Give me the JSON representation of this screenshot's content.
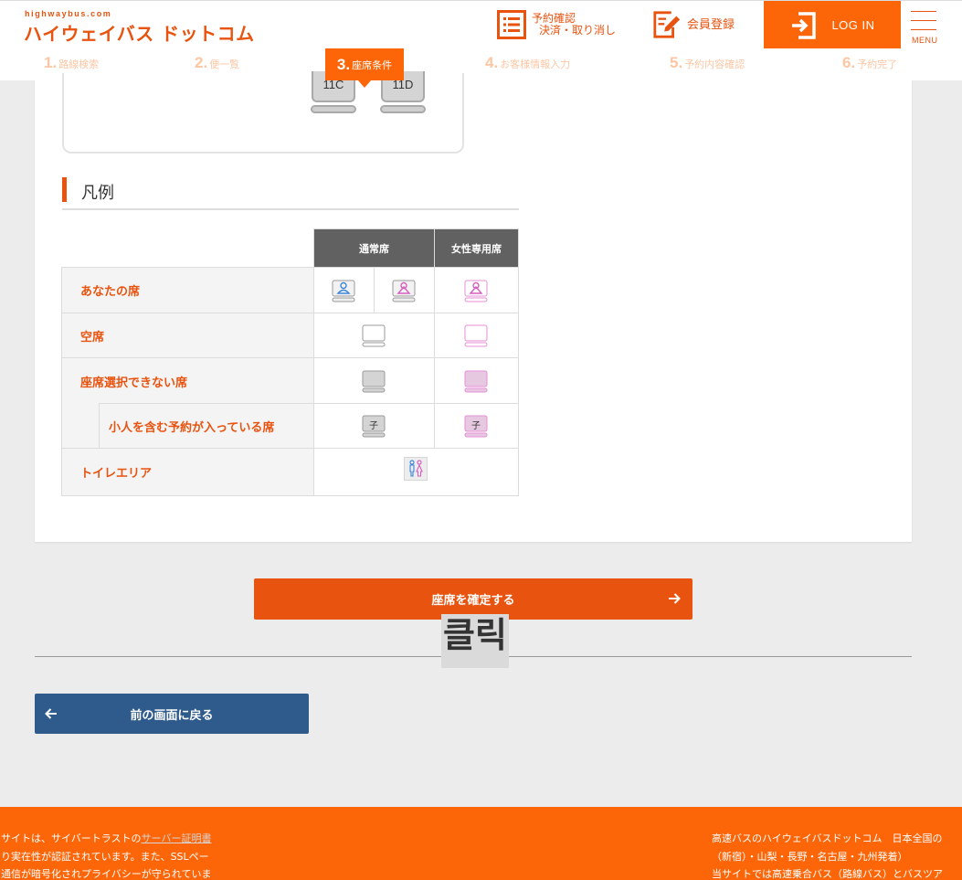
{
  "header": {
    "logo_small": "highwaybus.com",
    "logo_main": "ハイウェイバス ドットコム",
    "reservation_line1": "予約確認",
    "reservation_line2": "決済・取り消し",
    "register": "会員登録",
    "login": "LOG IN",
    "menu": "MENU"
  },
  "steps": [
    {
      "num": "1.",
      "label": "路線検索"
    },
    {
      "num": "2.",
      "label": "便一覧"
    },
    {
      "num": "3.",
      "label": "座席条件"
    },
    {
      "num": "4.",
      "label": "お客様情報入力"
    },
    {
      "num": "5.",
      "label": "予約内容確認"
    },
    {
      "num": "6.",
      "label": "予約完了"
    }
  ],
  "active_step": 3,
  "seatmap": {
    "seats": [
      "11C",
      "11D"
    ]
  },
  "legend": {
    "title": "凡例",
    "col_normal": "通常席",
    "col_female": "女性専用席",
    "rows": {
      "your_seat": "あなたの席",
      "empty": "空席",
      "unavailable": "座席選択できない席",
      "child": "小人を含む予約が入っている席",
      "toilet": "トイレエリア"
    },
    "child_mark": "子"
  },
  "buttons": {
    "confirm": "座席を確定する",
    "back": "前の画面に戻る"
  },
  "overlay": {
    "click": "클릭"
  },
  "footer": {
    "left_line1_prefix": "サイトは、サイバートラストの",
    "left_line1_link": "サーバー証明書",
    "left_line2": "り実在性が認証されています。また、SSLペー",
    "left_line3": "通信が暗号化されプライバシーが守られていま",
    "right_line1": "高速バスのハイウェイバスドットコム　日本全国の",
    "right_line2": "（新宿）・山梨・長野・名古屋・九州発着）",
    "right_line3": "当サイトでは高速乗合バス（路線バス）とバスツア"
  },
  "colors": {
    "brand_orange": "#fc6608",
    "button_orange": "#e8530f",
    "back_blue": "#2f5b8c",
    "header_gray": "#616161",
    "female_pink": "#e58fd6",
    "male_blue": "#3f86d6"
  }
}
